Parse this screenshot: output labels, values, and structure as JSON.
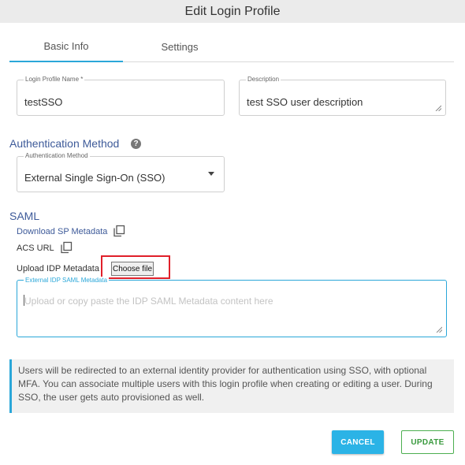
{
  "window": {
    "title": "Edit Login Profile"
  },
  "tabs": [
    {
      "label": "Basic Info",
      "active": true
    },
    {
      "label": "Settings",
      "active": false
    }
  ],
  "profile_name": {
    "label": "Login Profile Name *",
    "value": "testSSO"
  },
  "description": {
    "label": "Description",
    "value": "test SSO user description"
  },
  "auth_section": {
    "title": "Authentication Method",
    "help_icon": "question-circle-icon",
    "field_label": "Authentication Method",
    "selected": "External Single Sign-On (SSO)"
  },
  "saml": {
    "title": "SAML",
    "download_link": "Download SP Metadata",
    "acs_label": "ACS URL",
    "upload_label": "Upload IDP Metadata",
    "choose_file": "Choose file",
    "metadata_label": "External IDP SAML Metadata",
    "metadata_placeholder": "Upload or copy paste the IDP SAML Metadata content here"
  },
  "info_text": "Users will be redirected to an external identity provider for authentication using SSO, with optional MFA. You can associate multiple users with this login profile when creating or editing a user. During SSO, the user gets auto provisioned as well.",
  "buttons": {
    "cancel": "CANCEL",
    "update": "UPDATE"
  },
  "colors": {
    "accent": "#2aa7d9",
    "section_title": "#3d5a99",
    "highlight": "#e0202a",
    "update_green": "#4caf50"
  }
}
